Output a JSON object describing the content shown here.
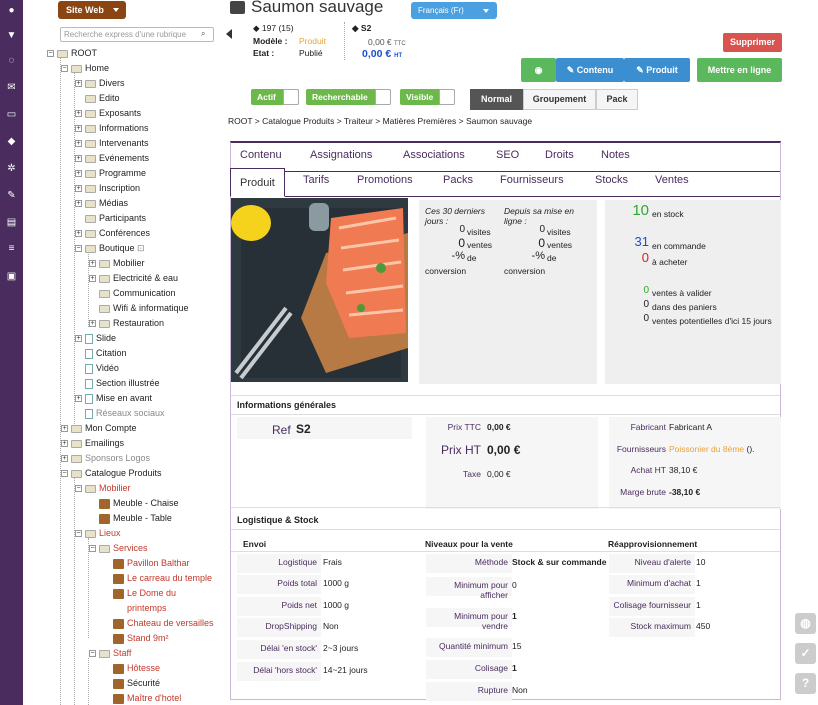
{
  "site_web": "Site Web",
  "tree_search_placeholder": "Recherche express d'une rubrique",
  "tree": [
    {
      "label": "ROOT",
      "type": "fld",
      "color": ""
    },
    {
      "label": "Home",
      "type": "fld",
      "color": ""
    },
    {
      "label": "Divers",
      "type": "fld",
      "color": ""
    },
    {
      "label": "Edito",
      "type": "fld",
      "color": ""
    },
    {
      "label": "Exposants",
      "type": "fld",
      "color": ""
    },
    {
      "label": "Informations",
      "type": "fld",
      "color": ""
    },
    {
      "label": "Intervenants",
      "type": "fld",
      "color": ""
    },
    {
      "label": "Evénements",
      "type": "fld",
      "color": ""
    },
    {
      "label": "Programme",
      "type": "fld",
      "color": ""
    },
    {
      "label": "Inscription",
      "type": "fld",
      "color": ""
    },
    {
      "label": "Médias",
      "type": "fld",
      "color": ""
    },
    {
      "label": "Participants",
      "type": "fld",
      "color": ""
    },
    {
      "label": "Conférences",
      "type": "fld",
      "color": ""
    },
    {
      "label": "Boutique",
      "type": "fld",
      "color": "",
      "lock": true
    },
    {
      "label": "Mobilier",
      "type": "fld",
      "color": ""
    },
    {
      "label": "Electricité & eau",
      "type": "fld",
      "color": ""
    },
    {
      "label": "Communication",
      "type": "fld",
      "color": ""
    },
    {
      "label": "Wifi & informatique",
      "type": "fld",
      "color": ""
    },
    {
      "label": "Restauration",
      "type": "fld",
      "color": ""
    },
    {
      "label": "Slide",
      "type": "doc",
      "color": ""
    },
    {
      "label": "Citation",
      "type": "doc",
      "color": ""
    },
    {
      "label": "Vidéo",
      "type": "doc",
      "color": ""
    },
    {
      "label": "Section illustrée",
      "type": "doc",
      "color": ""
    },
    {
      "label": "Mise en avant",
      "type": "doc",
      "color": ""
    },
    {
      "label": "Réseaux sociaux",
      "type": "doc",
      "color": "gray"
    },
    {
      "label": "Mon Compte",
      "type": "fld",
      "color": ""
    },
    {
      "label": "Emailings",
      "type": "fld",
      "color": ""
    },
    {
      "label": "Sponsors Logos",
      "type": "fld",
      "color": "gray"
    },
    {
      "label": "Catalogue Produits",
      "type": "fld",
      "color": ""
    },
    {
      "label": "Mobilier",
      "type": "fld",
      "color": "red"
    },
    {
      "label": "Meuble - Chaise",
      "type": "box",
      "color": ""
    },
    {
      "label": "Meuble - Table",
      "type": "box",
      "color": ""
    },
    {
      "label": "Lieux",
      "type": "fld",
      "color": "red"
    },
    {
      "label": "Services",
      "type": "fld",
      "color": "red"
    },
    {
      "label": "Pavillon Balthar",
      "type": "box",
      "color": "red"
    },
    {
      "label": "Le carreau du temple",
      "type": "box",
      "color": "red"
    },
    {
      "label": "Le Dome du",
      "type": "box",
      "color": "red"
    },
    {
      "label": "printemps",
      "type": "none",
      "color": "red"
    },
    {
      "label": "Chateau de versailles",
      "type": "box",
      "color": "red"
    },
    {
      "label": "Stand 9m²",
      "type": "box",
      "color": "red"
    },
    {
      "label": "Staff",
      "type": "fld",
      "color": "red"
    },
    {
      "label": "Hôtesse",
      "type": "box",
      "color": "red"
    },
    {
      "label": "Sécurité",
      "type": "box",
      "color": ""
    },
    {
      "label": "Maître d'hotel",
      "type": "box",
      "color": "red"
    }
  ],
  "page": {
    "title": "Saumon sauvage",
    "language": "Français (Fr)"
  },
  "meta": {
    "count": "197 (15)",
    "modele_label": "Modèle :",
    "modele_value": "Produit",
    "etat_label": "Etat :",
    "etat_value": "Publié",
    "ref": "S2",
    "price_ttc": "0,00 €",
    "ttc": "TTC",
    "price_ht": "0,00 €",
    "ht": "HT"
  },
  "buttons": {
    "delete": "Supprimer",
    "view_icon": "eye-icon",
    "contenu": "Contenu",
    "produit": "Produit",
    "online": "Mettre en ligne"
  },
  "toggles": {
    "actif": "Actif",
    "recherchable": "Recherchable",
    "visible": "Visible"
  },
  "view_modes": [
    "Normal",
    "Groupement",
    "Pack"
  ],
  "breadcrumb": "ROOT > Catalogue Produits > Traiteur > Matières Premières > Saumon sauvage",
  "tabs_top": [
    "Contenu",
    "Assignations",
    "Associations",
    "SEO",
    "Droits",
    "Notes"
  ],
  "tabs_bottom": [
    "Produit",
    "Tarifs",
    "Promotions",
    "Packs",
    "Fournisseurs",
    "Stocks",
    "Ventes"
  ],
  "stats": {
    "col1_title": "Ces 30 derniers jours :",
    "col2_title": "Depuis sa mise en ligne :",
    "visits": "0",
    "visits_label": "visites",
    "sales": "0",
    "sales_label": "ventes",
    "conv": "-%",
    "conv_label1": "de",
    "conv_label2": "conversion"
  },
  "stock": {
    "in_stock": "10",
    "in_stock_label": "en stock",
    "ordered": "31",
    "ordered_label": "en commande",
    "to_buy": "0",
    "to_buy_label": "à acheter",
    "to_validate": "0",
    "to_validate_label": "ventes à valider",
    "in_carts": "0",
    "in_carts_label": "dans des paniers",
    "potential": "0",
    "potential_label": "ventes potentielles d'ici 15 jours"
  },
  "general": {
    "title": "Informations générales",
    "ref_label": "Ref",
    "ref_value": "S2",
    "prix_ttc_label": "Prix TTC",
    "prix_ttc": "0,00 €",
    "prix_ht_label": "Prix HT",
    "prix_ht": "0,00 €",
    "taxe_label": "Taxe",
    "taxe": "0,00 €",
    "fabricant_label": "Fabricant",
    "fabricant": "Fabricant A",
    "fournisseurs_label": "Fournisseurs",
    "fournisseur": "Poissonier du 8ème",
    "fournisseur_suffix": "().",
    "achat_label": "Achat HT",
    "achat": "38,10 €",
    "marge_label": "Marge brute",
    "marge": "-38,10 €"
  },
  "logistics": {
    "title": "Logistique & Stock",
    "envoi": "Envoi",
    "niveaux": "Niveaux pour la vente",
    "reappro": "Réapprovisionnement",
    "col1": [
      [
        "Logistique",
        "Frais"
      ],
      [
        "Poids total",
        "1000 g"
      ],
      [
        "Poids net",
        "1000 g"
      ],
      [
        "DropShipping",
        "Non"
      ],
      [
        "Délai 'en stock'",
        "2~3 jours"
      ],
      [
        "Délai 'hors stock'",
        "14~21 jours"
      ]
    ],
    "col2": [
      [
        "Méthode",
        "Stock & sur commande"
      ],
      [
        "Minimum pour afficher",
        "0"
      ],
      [
        "Minimum pour vendre",
        "1"
      ],
      [
        "Quantité minimum",
        "15"
      ],
      [
        "Colisage",
        "1"
      ],
      [
        "Rupture",
        "Non"
      ]
    ],
    "col3": [
      [
        "Niveau d'alerte",
        "10"
      ],
      [
        "Minimum d'achat",
        "1"
      ],
      [
        "Colisage fournisseur",
        "1"
      ],
      [
        "Stock maximum",
        "450"
      ]
    ]
  },
  "colors": {
    "purple": "#4a2c5e",
    "green": "#6cb84a",
    "blue": "#3b8fd0",
    "red": "#d9534f"
  }
}
